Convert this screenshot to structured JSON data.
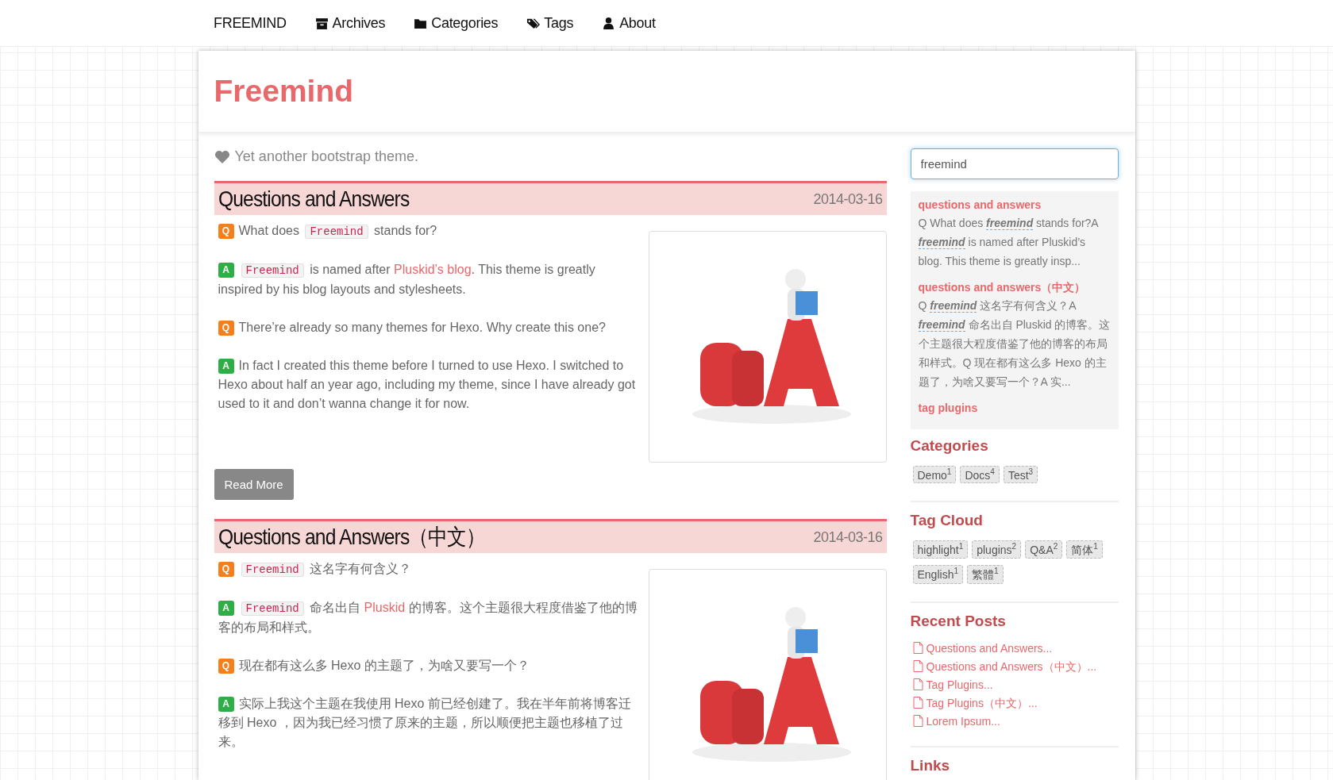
{
  "nav": {
    "brand": "FREEMIND",
    "items": [
      {
        "label": "Archives",
        "kind": "archive"
      },
      {
        "label": "Categories",
        "kind": "folder"
      },
      {
        "label": "Tags",
        "kind": "tags"
      },
      {
        "label": "About",
        "kind": "user"
      }
    ]
  },
  "header": {
    "title": "Freemind"
  },
  "description": "Yet another bootstrap theme.",
  "posts": [
    {
      "title": "Questions and Answers",
      "date": "2014-03-16",
      "paragraphs": [
        {
          "kind": "q",
          "badge": "Q",
          "parts": [
            {
              "kind": "text",
              "text": "What does "
            },
            {
              "kind": "code",
              "text": "Freemind"
            },
            {
              "kind": "text",
              "text": " stands for?"
            }
          ]
        },
        {
          "kind": "a",
          "badge": "A",
          "parts": [
            {
              "kind": "code",
              "text": "Freemind"
            },
            {
              "kind": "text",
              "text": " is named after "
            },
            {
              "kind": "link",
              "text": "Pluskid’s blog"
            },
            {
              "kind": "text",
              "text": ". This theme is greatly inspired by his blog layouts and stylesheets."
            }
          ]
        },
        {
          "kind": "q",
          "badge": "Q",
          "parts": [
            {
              "kind": "text",
              "text": "There’re already so many themes for Hexo. Why create this one?"
            }
          ]
        },
        {
          "kind": "a",
          "badge": "A",
          "parts": [
            {
              "kind": "text",
              "text": "In fact I created this theme before I turned to use Hexo. I switched to Hexo about half an year ago, including my theme, since I have already got used to it and don’t wanna change it for now."
            }
          ]
        }
      ],
      "button": "Read More"
    },
    {
      "title": "Questions and Answers（中文）",
      "date": "2014-03-16",
      "paragraphs": [
        {
          "kind": "q",
          "badge": "Q",
          "parts": [
            {
              "kind": "code",
              "text": "Freemind"
            },
            {
              "kind": "text",
              "text": " 这名字有何含义？"
            }
          ]
        },
        {
          "kind": "a",
          "badge": "A",
          "parts": [
            {
              "kind": "code",
              "text": "Freemind"
            },
            {
              "kind": "text",
              "text": " 命名出自 "
            },
            {
              "kind": "link",
              "text": "Pluskid"
            },
            {
              "kind": "text",
              "text": " 的博客。这个主题很大程度借鉴了他的博客的布局和样式。"
            }
          ]
        },
        {
          "kind": "q",
          "badge": "Q",
          "parts": [
            {
              "kind": "text",
              "text": "现在都有这么多 Hexo 的主题了，为啥又要写一个？"
            }
          ]
        },
        {
          "kind": "a",
          "badge": "A",
          "parts": [
            {
              "kind": "text",
              "text": "实际上我这个主题在我使用 Hexo 前已经创建了。我在半年前将博客迁移到 Hexo ，因为我已经习惯了原来的主题，所以顺便把主题也移植了过来。"
            }
          ]
        }
      ]
    }
  ],
  "sidebar": {
    "search": {
      "value": "freemind"
    },
    "results": [
      {
        "title": "questions and answers",
        "snippet": "Q What does **freemind** stands for?A **freemind** is named after Pluskid’s blog. This theme is greatly insp..."
      },
      {
        "title": "questions and answers（中文）",
        "snippet": "Q **freemind** 这名字有何含义？A **freemind** 命名出自 Pluskid 的博客。这个主题很大程度借鉴了他的博客的布局和样式。Q 现在都有这么多 Hexo 的主题了，为啥又要写一个？A 实..."
      },
      {
        "title": "tag plugins"
      }
    ],
    "categories": {
      "heading": "Categories",
      "items": [
        {
          "label": "Demo",
          "count": "1"
        },
        {
          "label": "Docs",
          "count": "4"
        },
        {
          "label": "Test",
          "count": "3"
        }
      ]
    },
    "tag_cloud": {
      "heading": "Tag Cloud",
      "items": [
        {
          "label": "highlight",
          "count": "1"
        },
        {
          "label": "plugins",
          "count": "2"
        },
        {
          "label": "Q&A",
          "count": "2"
        },
        {
          "label": "简体",
          "count": "1"
        },
        {
          "label": "English",
          "count": "1"
        },
        {
          "label": "繁體",
          "count": "1"
        }
      ]
    },
    "recent_posts": {
      "heading": "Recent Posts",
      "items": [
        "Questions and Answers...",
        "Questions and Answers（中文）...",
        "Tag Plugins...",
        "Tag Plugins（中文）...",
        "Lorem Ipsum..."
      ]
    },
    "links": {
      "heading": "Links"
    }
  }
}
